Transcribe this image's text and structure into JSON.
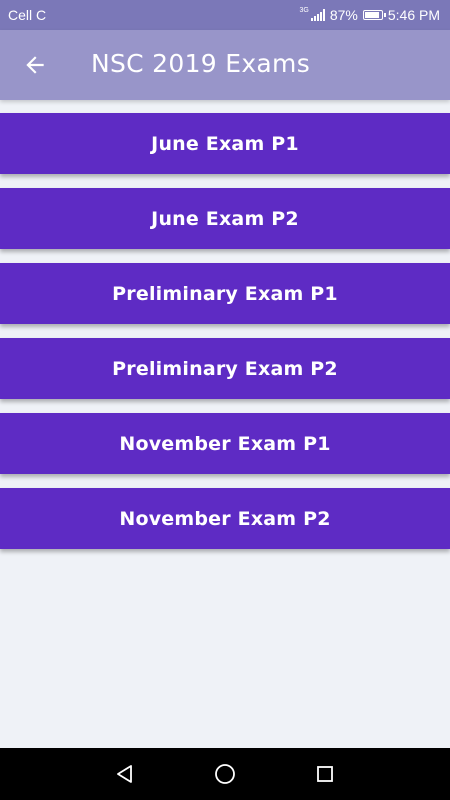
{
  "status_bar": {
    "carrier": "Cell C",
    "network_type": "3G",
    "battery": "87%",
    "time": "5:46 PM",
    "battery_level": 0.87
  },
  "app_bar": {
    "title": "NSC 2019 Exams",
    "back_icon": "arrow-left-icon"
  },
  "exams": [
    {
      "label": "June Exam P1"
    },
    {
      "label": "June Exam P2"
    },
    {
      "label": "Preliminary Exam P1"
    },
    {
      "label": "Preliminary Exam P2"
    },
    {
      "label": "November Exam P1"
    },
    {
      "label": "November Exam P2"
    }
  ],
  "nav_bar": {
    "icons": [
      "back-triangle-icon",
      "home-circle-icon",
      "recents-square-icon"
    ]
  },
  "colors": {
    "status_bar": "#7b78b8",
    "app_bar": "#9895c9",
    "button": "#5e2bc4",
    "background": "#eff2f7",
    "nav_bar": "#000000"
  }
}
